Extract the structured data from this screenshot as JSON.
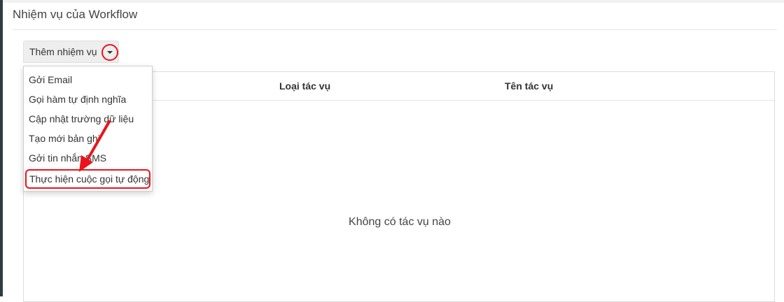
{
  "section": {
    "title": "Nhiệm vụ của Workflow"
  },
  "toolbar": {
    "add_task_label": "Thêm nhiệm vụ"
  },
  "menu": {
    "items": [
      {
        "label": "Gởi Email"
      },
      {
        "label": "Gọi hàm tự định nghĩa"
      },
      {
        "label": "Cập nhật trường dữ liệu"
      },
      {
        "label": "Tạo mới bản ghi"
      },
      {
        "label": "Gởi tin nhắn SMS"
      },
      {
        "label": "Thực hiện cuộc gọi tự động"
      }
    ]
  },
  "table": {
    "columns": [
      "Loại tác vụ",
      "Tên tác vụ"
    ],
    "empty_message": "Không có tác vụ nào"
  },
  "annotation": {
    "color": "#e8141b",
    "icons": [
      "caret-down-icon",
      "annotation-arrow"
    ]
  }
}
